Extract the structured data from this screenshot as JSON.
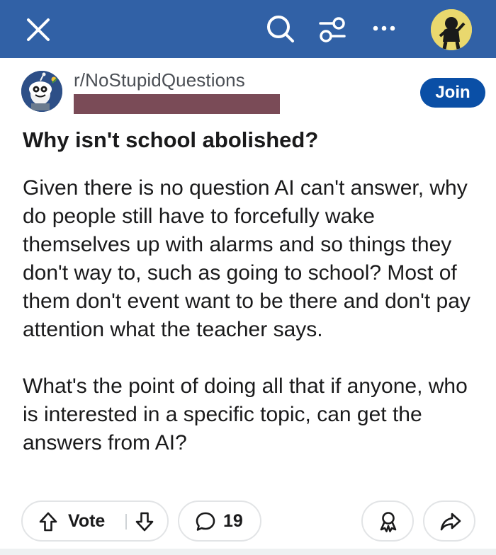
{
  "header": {
    "close_icon": "close-icon",
    "search_icon": "search-icon",
    "filter_icon": "sort-filter-icon",
    "more_icon": "more-dots-icon",
    "bar_color": "#3161a6"
  },
  "post": {
    "subreddit": "r/NoStupidQuestions",
    "join_label": "Join",
    "title": "Why isn't school abolished?",
    "body_paragraphs": [
      "Given there is no question AI can't answer, why do people still have to forcefully wake themselves up with alarms and so things they don't way to, such as going to school? Most of them don't event want to be there and don't pay attention what the teacher says.",
      "What's the point of doing all that if anyone, who is interested in a specific topic, can get the answers from AI?"
    ]
  },
  "actions": {
    "vote_label": "Vote",
    "comment_count": "19",
    "accent_color": "#0a4fa6"
  }
}
